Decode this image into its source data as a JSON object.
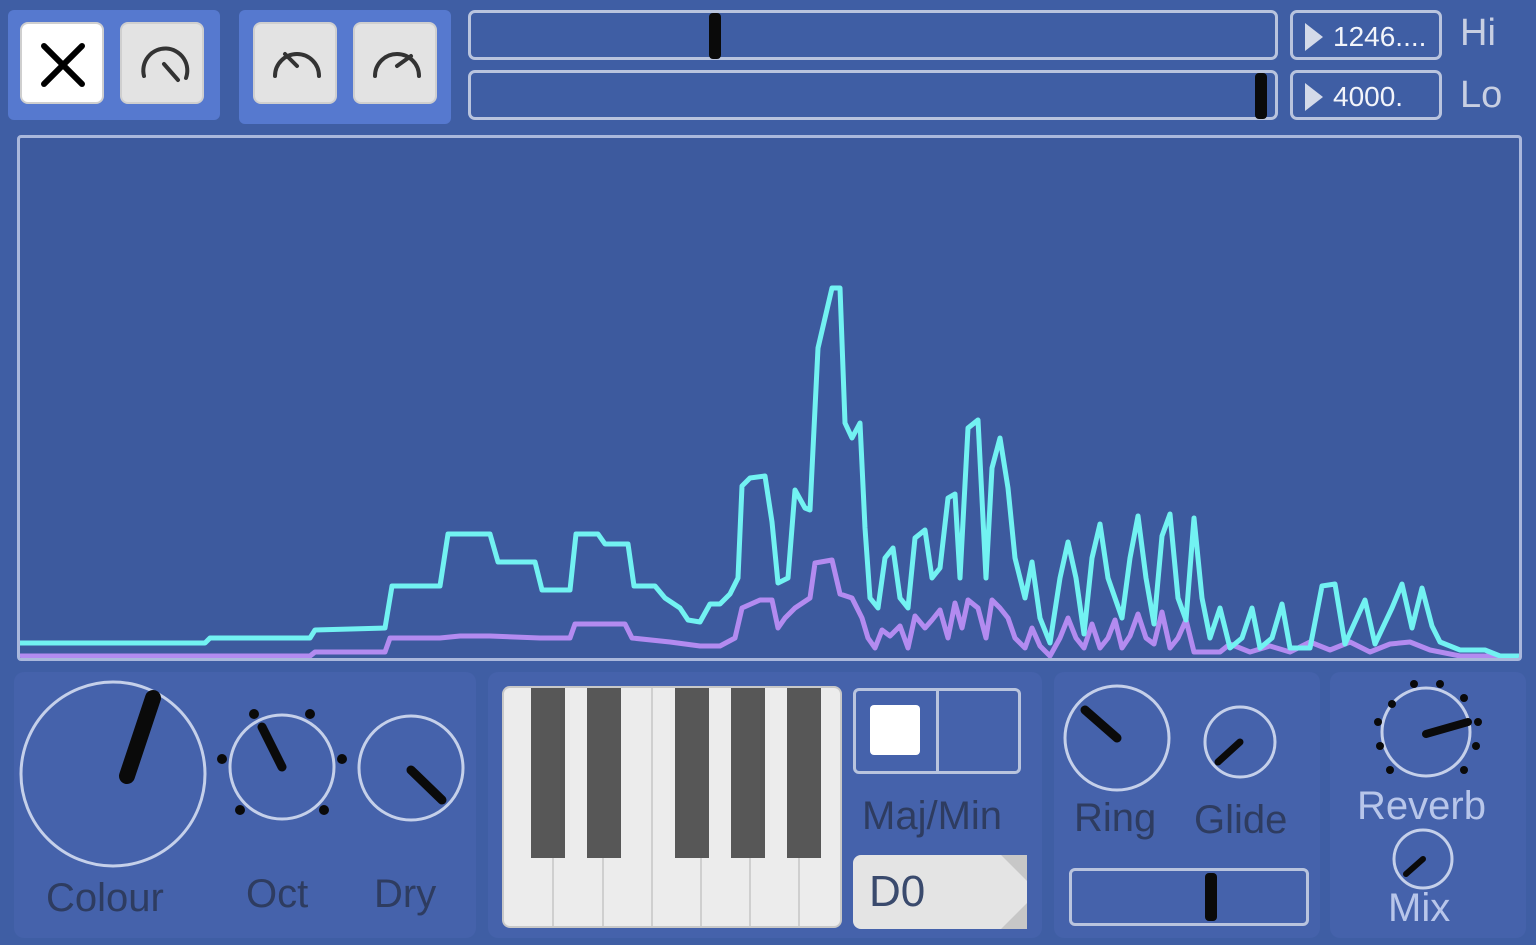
{
  "toolbar": {
    "group1": [
      {
        "icon": "close-icon"
      },
      {
        "icon": "dial-icon"
      }
    ],
    "group2": [
      {
        "icon": "dial-low-icon"
      },
      {
        "icon": "dial-high-icon"
      }
    ]
  },
  "range": {
    "hi": {
      "label": "Hi",
      "value": "1246....",
      "position": 0.3
    },
    "lo": {
      "label": "Lo",
      "value": "4000.",
      "position": 0.99
    }
  },
  "colors": {
    "background": "#3f5ea4",
    "spectrum_cyan": "#72f2f2",
    "spectrum_purple": "#b38bf0",
    "knob_indicator": "#0a0a0a"
  },
  "controls": {
    "colour": {
      "label": "Colour"
    },
    "oct": {
      "label": "Oct"
    },
    "dry": {
      "label": "Dry"
    },
    "scale": {
      "label": "Maj/Min",
      "state": "major"
    },
    "note": {
      "value": "D0"
    },
    "ring": {
      "label": "Ring"
    },
    "glide": {
      "label": "Glide",
      "slider_position": 0.6
    },
    "reverb": {
      "label": "Reverb"
    },
    "mix": {
      "label": "Mix"
    }
  }
}
